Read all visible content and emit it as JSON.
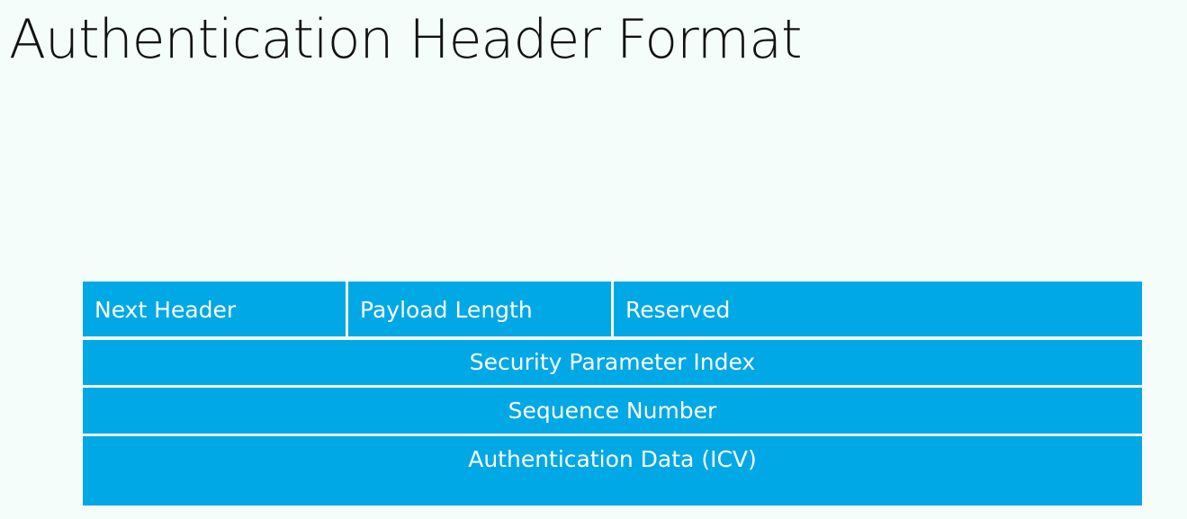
{
  "slide": {
    "title": "Authentication Header Format"
  },
  "diagram": {
    "row1": {
      "next_header": "Next Header",
      "payload_length": "Payload Length",
      "reserved": "Reserved"
    },
    "security_parameter_index": "Security Parameter Index",
    "sequence_number": "Sequence Number",
    "authentication_data": "Authentication Data (ICV)"
  },
  "colors": {
    "background": "#f4fdf9",
    "field_fill": "#00a8e6",
    "field_text": "#ffffff",
    "title_text": "#111111"
  }
}
